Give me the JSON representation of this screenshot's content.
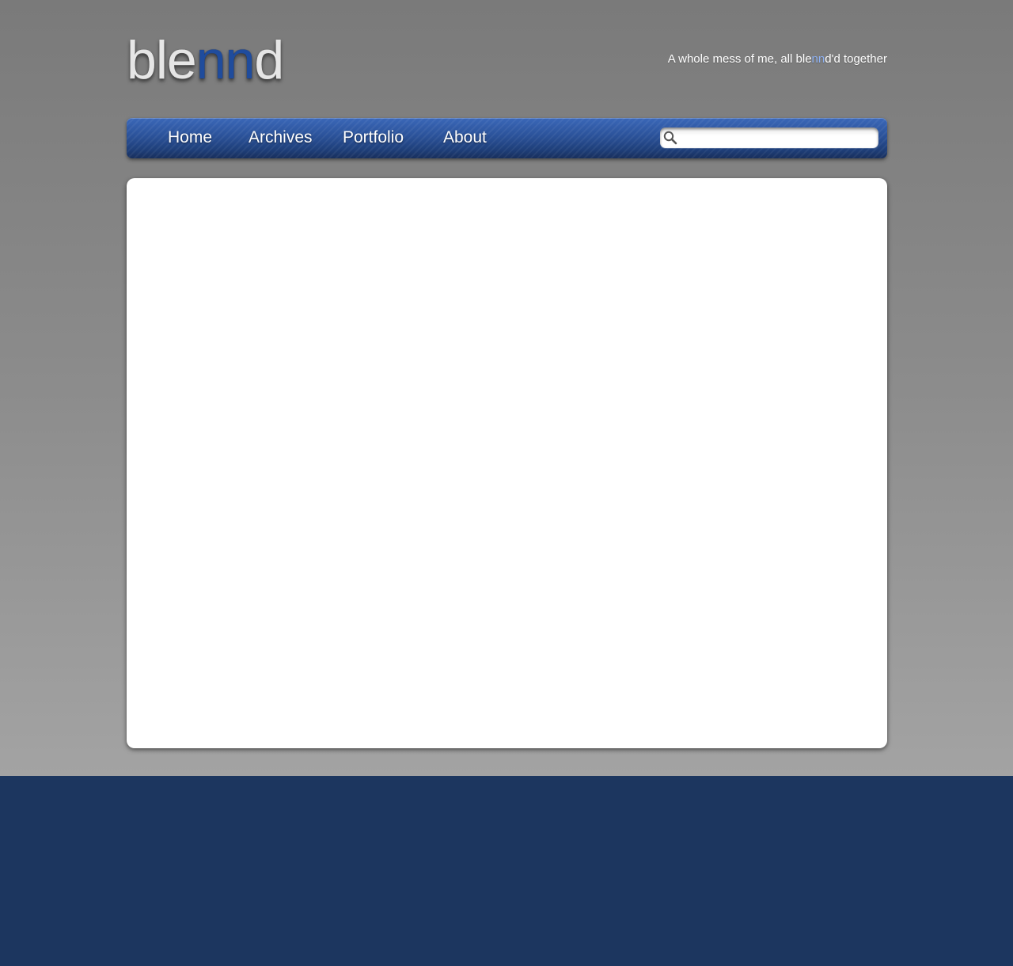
{
  "header": {
    "logo": {
      "part1": "ble",
      "part2": "nn",
      "part3": "d"
    },
    "tagline": {
      "before": "A whole mess of me, all ble",
      "highlight": "nn",
      "after": "d'd together"
    }
  },
  "nav": {
    "items": [
      {
        "label": "Home"
      },
      {
        "label": "Archives"
      },
      {
        "label": "Portfolio"
      },
      {
        "label": "About"
      }
    ],
    "search": {
      "value": "",
      "placeholder": "",
      "icon": "search-icon"
    }
  },
  "colors": {
    "accent_blue": "#2b5299",
    "footer": "#1c365f",
    "tagline_highlight": "#8db0f2"
  }
}
